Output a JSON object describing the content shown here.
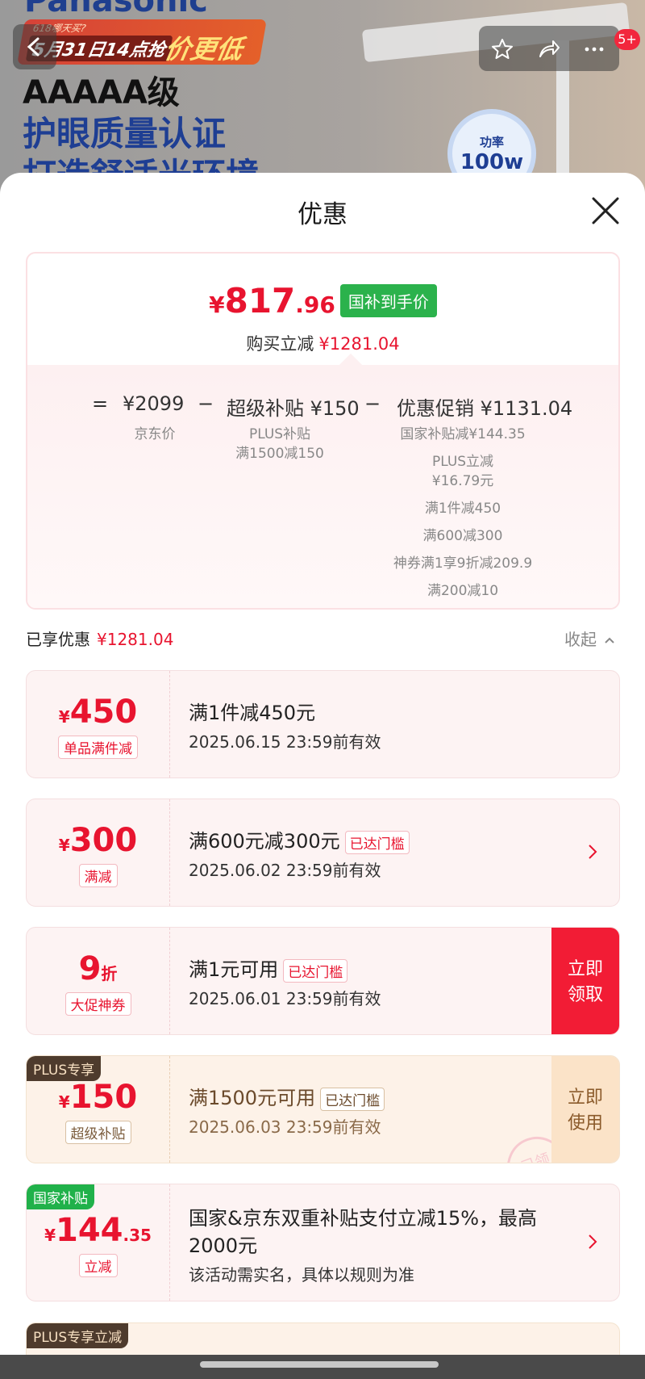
{
  "banner": {
    "brand": "Panasonic",
    "promo_small": "618哪天买?",
    "promo_date": "5月31日14点抢",
    "promo_big": "价更低",
    "line1": "AAAAA级",
    "line2": "护眼质量认证",
    "line3": "打造舒适光环境",
    "power_label": "功率",
    "power_value": "100w"
  },
  "top_bar": {
    "badge": "5+"
  },
  "sheet": {
    "title": "优惠"
  },
  "summary": {
    "price_symbol": "¥",
    "price_int": "817",
    "price_dec": ".96",
    "price_tag": "国补到手价",
    "reduce_label": "购买立减",
    "reduce_amount": "¥1281.04",
    "equals": "=",
    "jd_price": "¥2099",
    "jd_price_label": "京东价",
    "minus1": "−",
    "super_subsidy": "超级补贴 ¥150",
    "super_sub_l1": "PLUS补贴",
    "super_sub_l2": "满1500减150",
    "minus2": "−",
    "promo": "优惠促销 ¥1131.04",
    "promo_items": [
      "国家补贴减¥144.35",
      "PLUS立减",
      "¥16.79元",
      "满1件减450",
      "满600减300",
      "神券满1享9折减209.9",
      "满200减10"
    ]
  },
  "enjoyed": {
    "label": "已享优惠",
    "amount": "¥1281.04",
    "collapse": "收起"
  },
  "coupons": [
    {
      "sym": "¥",
      "num": "450",
      "tag": "单品满件减",
      "title": "满1件减450元",
      "subtitle": "2025.06.15 23:59前有效"
    },
    {
      "sym": "¥",
      "num": "300",
      "tag": "满减",
      "title": "满600元减300元",
      "reached": "已达门槛",
      "subtitle": "2025.06.02 23:59前有效"
    },
    {
      "num": "9",
      "unit": "折",
      "tag": "大促神券",
      "title": "满1元可用",
      "reached": "已达门槛",
      "subtitle": "2025.06.01 23:59前有效",
      "action_l1": "立即",
      "action_l2": "领取"
    },
    {
      "corner": "PLUS专享",
      "sym": "¥",
      "num": "150",
      "tag": "超级补贴",
      "title": "满1500元可用",
      "reached": "已达门槛",
      "subtitle": "2025.06.03 23:59前有效",
      "action_l1": "立即",
      "action_l2": "使用",
      "stamp": "已领"
    },
    {
      "corner": "国家补贴",
      "sym": "¥",
      "num": "144",
      "dec": ".35",
      "tag": "立减",
      "title_l1": "国家&京东双重补贴支付立减15%，最高",
      "title_l2": "2000元",
      "subtitle": "该活动需实名，具体以规则为准"
    },
    {
      "corner": "PLUS专享立减"
    }
  ],
  "colors": {
    "accent_red": "#e8142f",
    "tag_green": "#2bb24c",
    "plus_dark": "#4e3b2d"
  }
}
